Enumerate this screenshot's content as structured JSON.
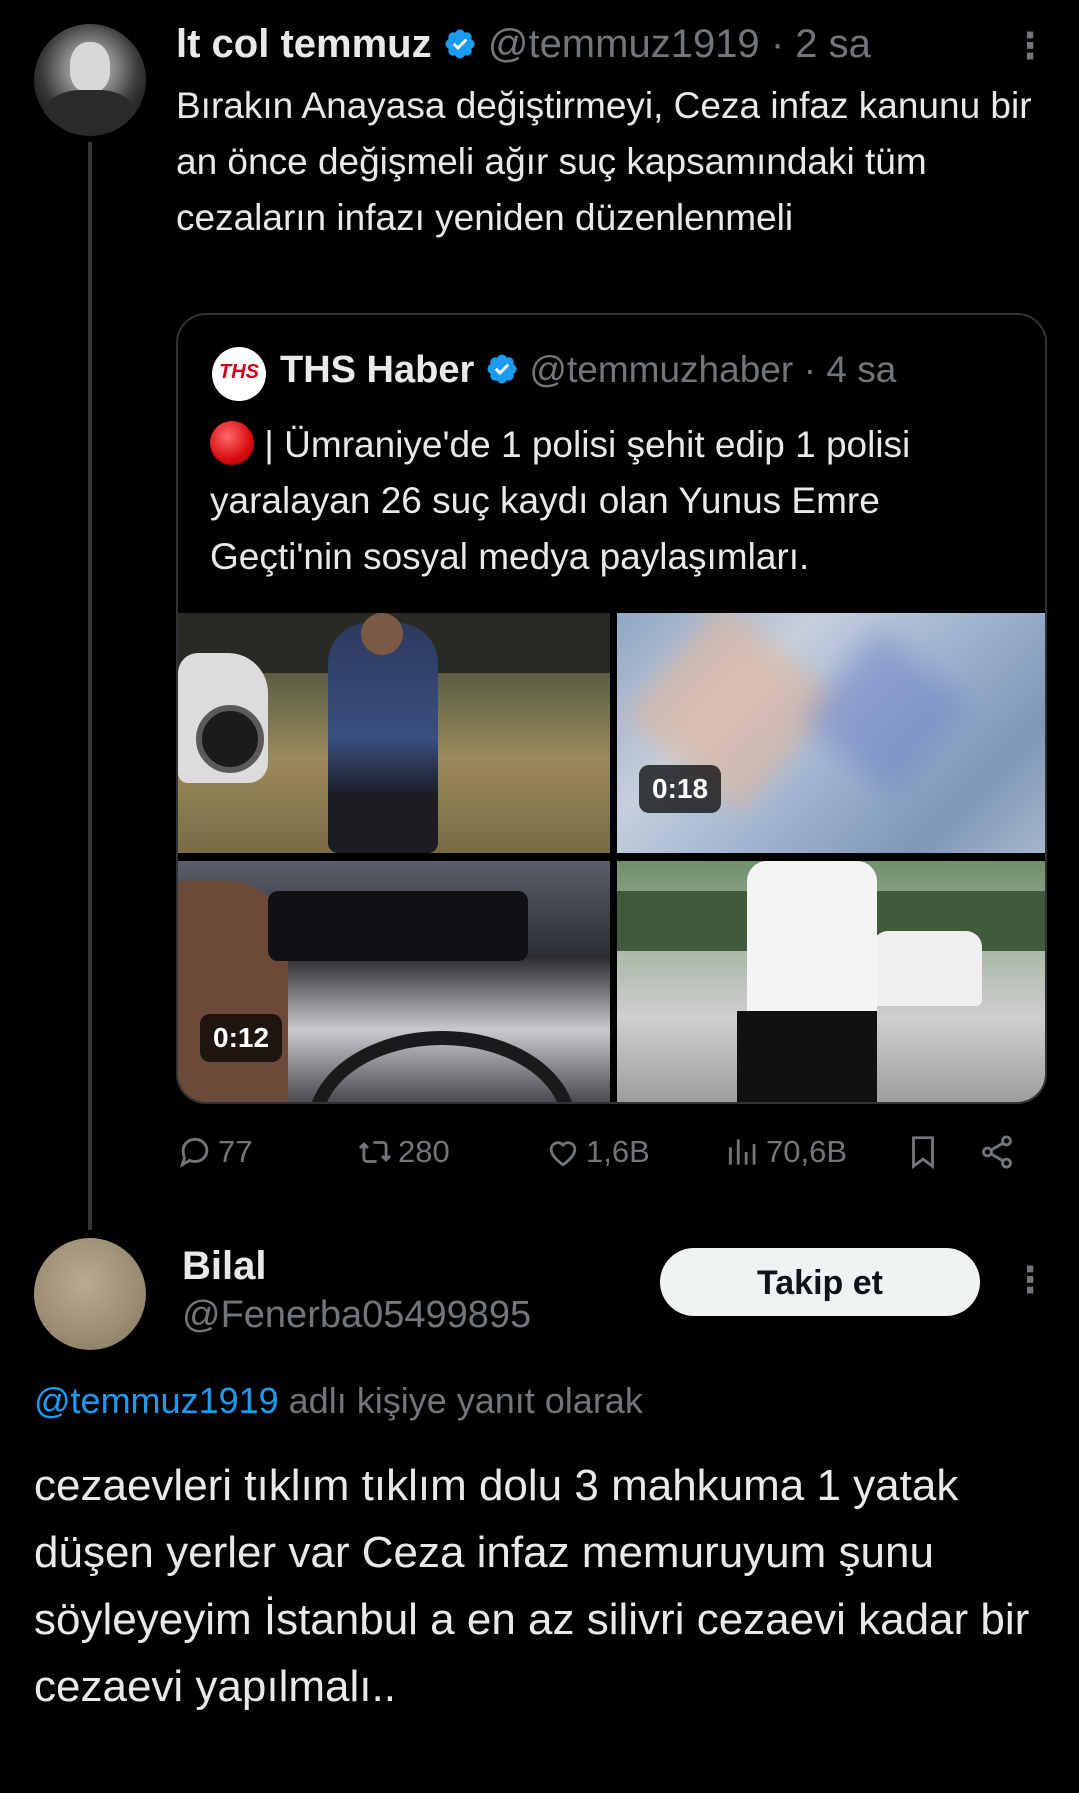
{
  "tweet": {
    "author_name": "lt col temmuz",
    "author_handle": "@temmuz1919",
    "time": "· 2 sa",
    "text": "Bırakın Anayasa değiştirmeyi, Ceza infaz kanunu bir an önce değişmeli ağır suç kapsamındaki tüm cezaların infazı yeniden düzenlenmeli",
    "more_label": "⋮",
    "verified_icon": "verified-badge",
    "accent_color": "#1d9bf0"
  },
  "quote": {
    "logo_text": "THS",
    "author_name": "THS Haber",
    "author_handle": "@temmuzhaber",
    "time": "· 4 sa",
    "text": "| Ümraniye'de 1 polisi şehit edip 1 polisi yaralayan 26 suç kaydı olan Yunus Emre Geçti'nin sosyal medya paylaşımları.",
    "media": [
      {
        "duration": ""
      },
      {
        "duration": "0:18"
      },
      {
        "duration": "0:12"
      },
      {
        "duration": ""
      }
    ]
  },
  "actions": {
    "replies": "77",
    "reposts": "280",
    "likes": "1,6B",
    "views": "70,6B"
  },
  "reply": {
    "author_name": "Bilal",
    "author_handle": "@Fenerba05499895",
    "follow_label": "Takip et",
    "more_label": "⋮",
    "reply_to_mention": "@temmuz1919",
    "reply_to_suffix": " adlı kişiye yanıt olarak",
    "text": "cezaevleri tıklım tıklım dolu 3 mahkuma 1 yatak düşen yerler var Ceza infaz memuruyum şunu söyleyeyim İstanbul a en az silivri cezaevi kadar bir cezaevi yapılmalı.."
  }
}
